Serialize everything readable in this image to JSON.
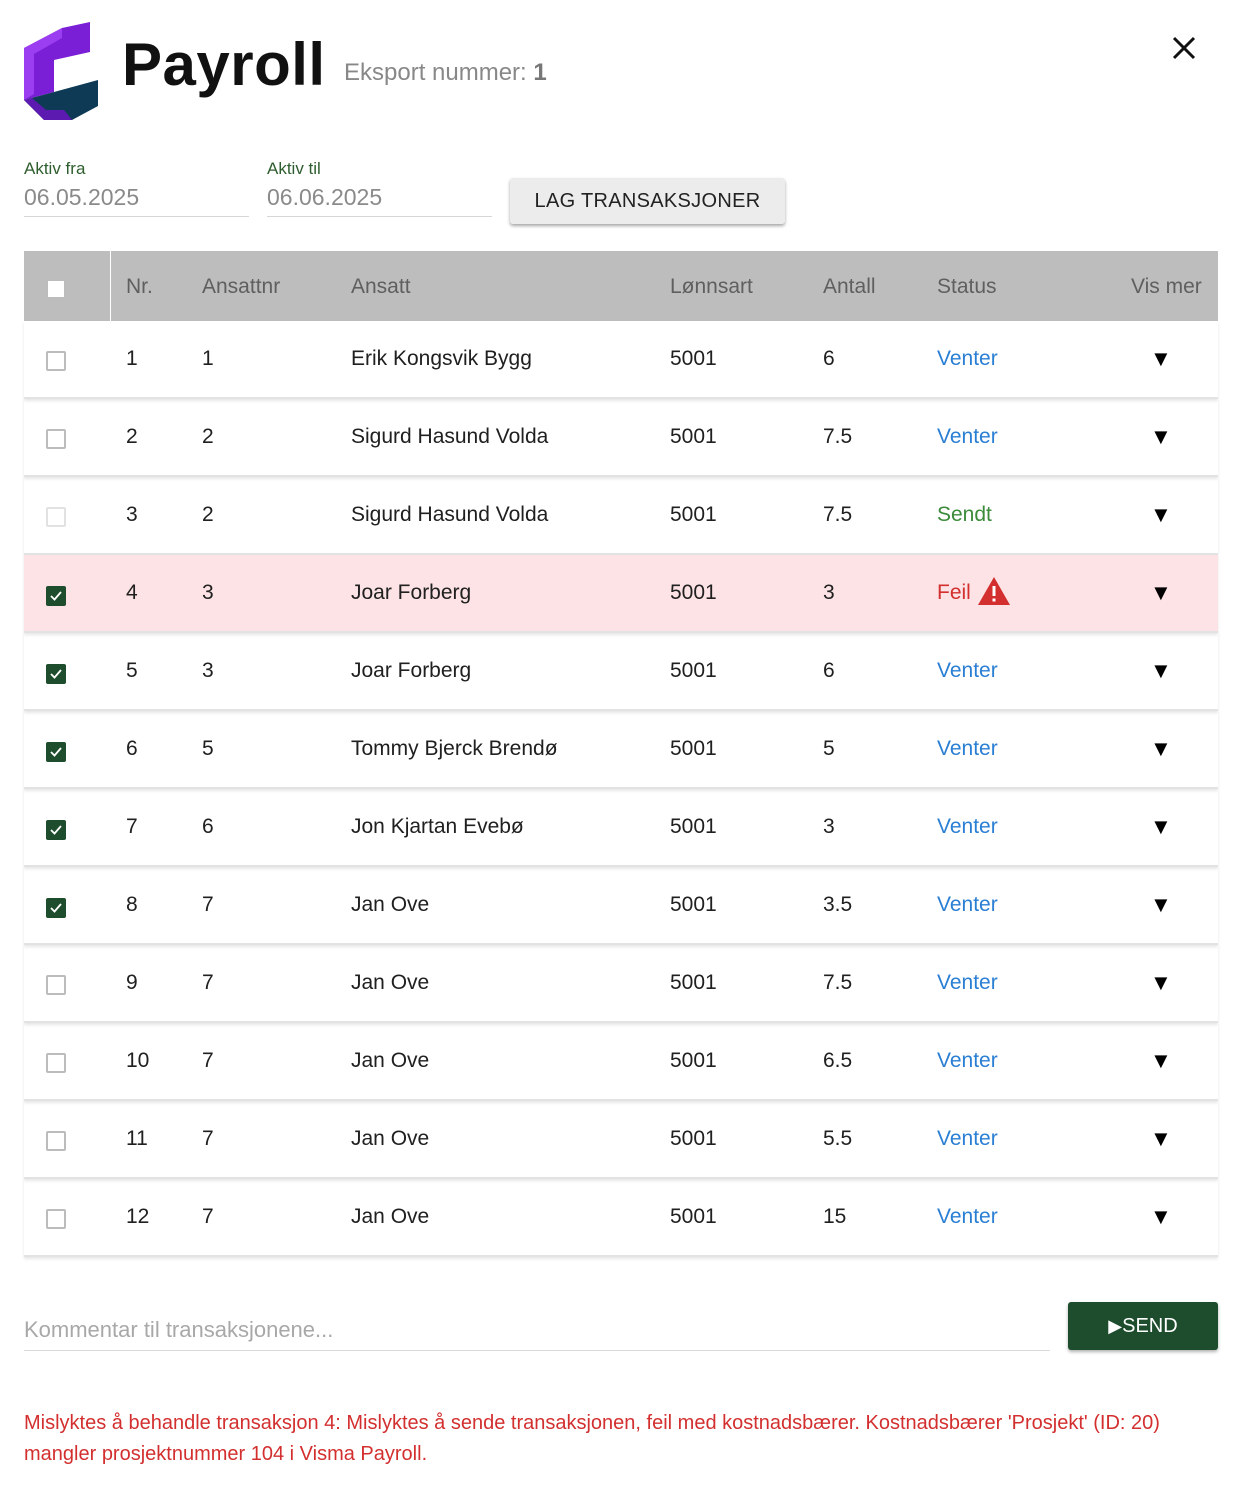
{
  "header": {
    "app_name": "Payroll",
    "export_label": "Eksport nummer:",
    "export_number": "1",
    "logo_icon": "payroll-logo-icon",
    "close_icon": "close-icon"
  },
  "filters": {
    "from_label": "Aktiv fra",
    "from_value": "06.05.2025",
    "to_label": "Aktiv til",
    "to_value": "06.06.2025",
    "generate_button": "LAG TRANSAKSJONER"
  },
  "table": {
    "headers": {
      "nr": "Nr.",
      "ansattnr": "Ansattnr",
      "ansatt": "Ansatt",
      "lonnsart": "Lønnsart",
      "antall": "Antall",
      "status": "Status",
      "vis_mer": "Vis mer"
    },
    "expand_glyph": "▼",
    "rows": [
      {
        "nr": "1",
        "ansattnr": "1",
        "ansatt": "Erik Kongsvik Bygg",
        "lonnsart": "5001",
        "antall": "6",
        "status": "Venter",
        "checkbox": "unchecked"
      },
      {
        "nr": "2",
        "ansattnr": "2",
        "ansatt": "Sigurd Hasund Volda",
        "lonnsart": "5001",
        "antall": "7.5",
        "status": "Venter",
        "checkbox": "unchecked"
      },
      {
        "nr": "3",
        "ansattnr": "2",
        "ansatt": "Sigurd Hasund Volda",
        "lonnsart": "5001",
        "antall": "7.5",
        "status": "Sendt",
        "checkbox": "disabled"
      },
      {
        "nr": "4",
        "ansattnr": "3",
        "ansatt": "Joar Forberg",
        "lonnsart": "5001",
        "antall": "3",
        "status": "Feil",
        "checkbox": "checked"
      },
      {
        "nr": "5",
        "ansattnr": "3",
        "ansatt": "Joar Forberg",
        "lonnsart": "5001",
        "antall": "6",
        "status": "Venter",
        "checkbox": "checked"
      },
      {
        "nr": "6",
        "ansattnr": "5",
        "ansatt": "Tommy Bjerck Brendø",
        "lonnsart": "5001",
        "antall": "5",
        "status": "Venter",
        "checkbox": "checked"
      },
      {
        "nr": "7",
        "ansattnr": "6",
        "ansatt": "Jon Kjartan Evebø",
        "lonnsart": "5001",
        "antall": "3",
        "status": "Venter",
        "checkbox": "checked"
      },
      {
        "nr": "8",
        "ansattnr": "7",
        "ansatt": "Jan Ove",
        "lonnsart": "5001",
        "antall": "3.5",
        "status": "Venter",
        "checkbox": "checked"
      },
      {
        "nr": "9",
        "ansattnr": "7",
        "ansatt": "Jan Ove",
        "lonnsart": "5001",
        "antall": "7.5",
        "status": "Venter",
        "checkbox": "unchecked"
      },
      {
        "nr": "10",
        "ansattnr": "7",
        "ansatt": "Jan Ove",
        "lonnsart": "5001",
        "antall": "6.5",
        "status": "Venter",
        "checkbox": "unchecked"
      },
      {
        "nr": "11",
        "ansattnr": "7",
        "ansatt": "Jan Ove",
        "lonnsart": "5001",
        "antall": "5.5",
        "status": "Venter",
        "checkbox": "unchecked"
      },
      {
        "nr": "12",
        "ansattnr": "7",
        "ansatt": "Jan Ove",
        "lonnsart": "5001",
        "antall": "15",
        "status": "Venter",
        "checkbox": "unchecked"
      }
    ]
  },
  "footer": {
    "comment_placeholder": "Kommentar til transaksjonene...",
    "send_icon": "play-icon",
    "send_label": "SEND",
    "error_message": "Mislyktes å behandle transaksjon 4: Mislyktes å sende transaksjonen, feil med kostnadsbærer. Kostnadsbærer 'Prosjekt' (ID: 20) mangler prosjektnummer 104 i Visma Payroll."
  },
  "colors": {
    "accent_green": "#1d4d2d",
    "status_waiting": "#2a7fd4",
    "status_sent": "#3b8b3b",
    "status_error": "#d32f2f",
    "error_row_bg": "#fde3e5",
    "header_bg": "#bdbdbd"
  }
}
